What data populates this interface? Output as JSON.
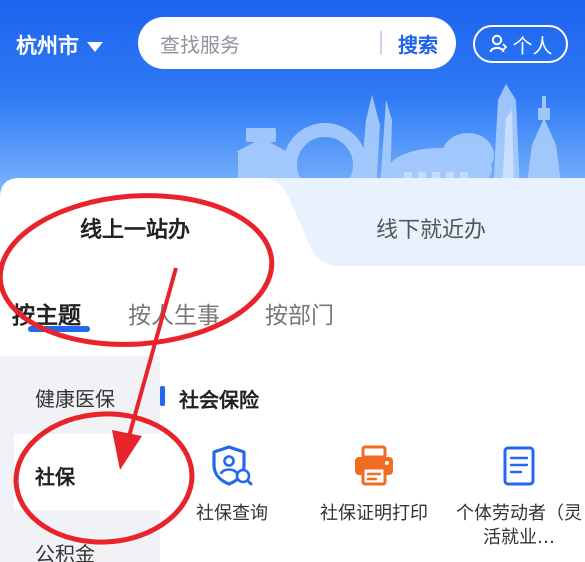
{
  "header": {
    "city": "杭州市",
    "search_placeholder": "查找服务",
    "search_button": "搜索",
    "personal_button": "个人"
  },
  "tabs": [
    {
      "label": "线上一站办",
      "active": true
    },
    {
      "label": "线下就近办",
      "active": false
    }
  ],
  "segments": [
    {
      "label": "按主题",
      "active": true
    },
    {
      "label": "按人生事",
      "active": false
    },
    {
      "label": "按部门",
      "active": false
    }
  ],
  "sidebar": {
    "items": [
      {
        "label": "健康医保"
      },
      {
        "label": "社保",
        "active": true
      },
      {
        "label": "公积金"
      }
    ]
  },
  "section": {
    "title": "社会保险",
    "services": [
      {
        "label": "社保查询",
        "icon": "shield-search-icon"
      },
      {
        "label": "社保证明打印",
        "icon": "printer-icon"
      },
      {
        "label": "个体劳动者（灵活就业…",
        "icon": "document-icon"
      }
    ]
  },
  "colors": {
    "accent": "#2468ee",
    "header_top": "#1d63ee",
    "annotation": "#e8232b",
    "printer_orange": "#f26b22"
  }
}
